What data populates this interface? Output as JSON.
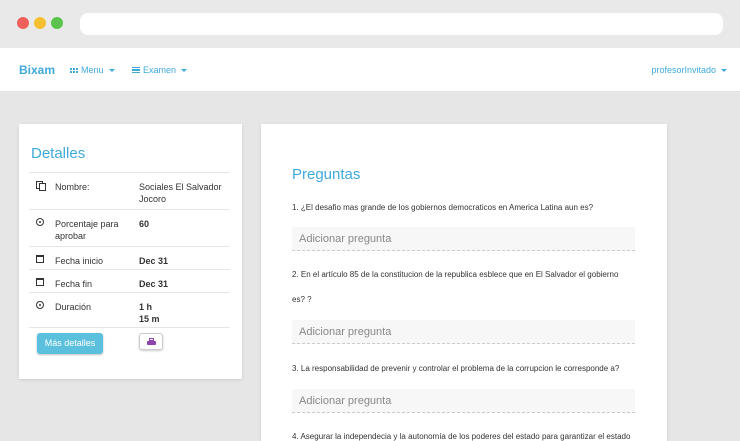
{
  "navbar": {
    "brand": "Bixam",
    "menu_label": "Menu",
    "exam_label": "Examen",
    "user_label": "profesorInvitado"
  },
  "details": {
    "title": "Detalles",
    "rows": [
      {
        "label": "Nombre:",
        "value": "Sociales El Salvador Jocoro",
        "icon": "copy-icon"
      },
      {
        "label": "Porcentaje para aprobar",
        "value": "60",
        "icon": "circle-dot-icon"
      },
      {
        "label": "Fecha inicio",
        "value": "Dec 31",
        "icon": "calendar-icon"
      },
      {
        "label": "Fecha fin",
        "value": "Dec 31",
        "icon": "calendar-icon"
      },
      {
        "label": "Duración",
        "value_line1": "1 h",
        "value_line2": "15 m",
        "icon": "circle-dot-icon"
      }
    ],
    "more_button": "Más detalles",
    "print_icon": "printer-icon"
  },
  "questions": {
    "title": "Preguntas",
    "items": [
      {
        "text": "1. ¿El desafio mas grande de los gobiernos democraticos en America Latina aun es?",
        "input_placeholder": "Adicionar pregunta"
      },
      {
        "text_line1": "2. En el artículo 85 de la constitucion de la republica esblece que en El Salvador el gobierno",
        "text_line2": "es? ?",
        "input_placeholder": "Adicionar pregunta"
      },
      {
        "text": "3. La responsabilidad de prevenir y controlar el problema de la corrupcion le corresponde a?",
        "input_placeholder": "Adicionar pregunta"
      },
      {
        "text": "4. Asegurar la independecia y la autonomía de los poderes del estado para garantizar el estado"
      }
    ]
  },
  "colors": {
    "accent": "#3fa9dc",
    "button": "#5bc0de",
    "print_icon": "#8e44ad"
  }
}
